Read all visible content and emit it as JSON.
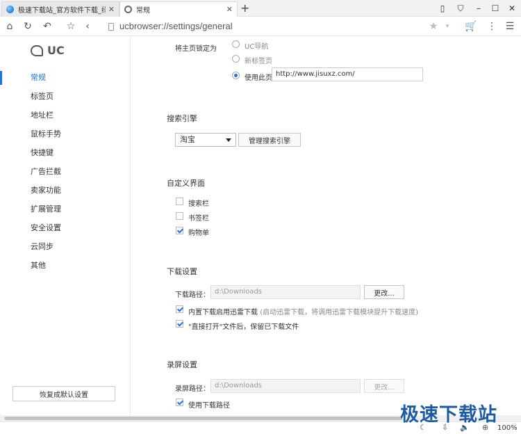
{
  "tabs": [
    {
      "title": "极速下载站_官方软件下载_绿色",
      "close": "✕"
    },
    {
      "title": "常规",
      "close": "✕"
    }
  ],
  "new_tab": "+",
  "window_controls": [
    "⦀",
    "👕",
    "–",
    "☐",
    "✕"
  ],
  "address": {
    "url": "ucbrowser://settings/general"
  },
  "nav_icons": [
    "home-icon",
    "refresh-icon",
    "undo-icon",
    "star-icon",
    "back-icon"
  ],
  "logo": {
    "text": "UC"
  },
  "sidebar": {
    "items": [
      {
        "label": "常规",
        "active": true
      },
      {
        "label": "标签页"
      },
      {
        "label": "地址栏"
      },
      {
        "label": "鼠标手势"
      },
      {
        "label": "快捷键"
      },
      {
        "label": "广告拦截"
      },
      {
        "label": "卖家功能"
      },
      {
        "label": "扩展管理"
      },
      {
        "label": "安全设置"
      },
      {
        "label": "云同步"
      },
      {
        "label": "其他"
      }
    ],
    "restore_button": "恢复成默认设置"
  },
  "homepage": {
    "label": "将主页锁定为",
    "options": [
      "UC导航",
      "新标签页",
      "使用此页"
    ],
    "selected": "使用此页",
    "url_value": "http://www.jisuxz.com/"
  },
  "search": {
    "heading": "搜索引擎",
    "engine": "淘宝",
    "manage_button": "管理搜索引擎"
  },
  "custom_ui": {
    "heading": "自定义界面",
    "items": [
      {
        "label": "搜索栏",
        "checked": false
      },
      {
        "label": "书签栏",
        "checked": false
      },
      {
        "label": "购物单",
        "checked": true
      }
    ]
  },
  "download": {
    "heading": "下载设置",
    "path_label": "下载路径：",
    "path_value": "d:\\Downloads",
    "change_button": "更改...",
    "thunder_label": "内置下载启用迅雷下载",
    "thunder_note": "(启动迅雷下载，将调用迅雷下载模块提升下载速度)",
    "direct_open_label": "\"直接打开\"文件后，保留已下载文件"
  },
  "record": {
    "heading": "录屏设置",
    "path_label": "录屏路径：",
    "path_value": "d:\\Downloads",
    "change_button": "更改...",
    "use_download_path": "使用下载路径"
  },
  "status": {
    "zoom": "100%"
  },
  "watermark": "极速下载站"
}
